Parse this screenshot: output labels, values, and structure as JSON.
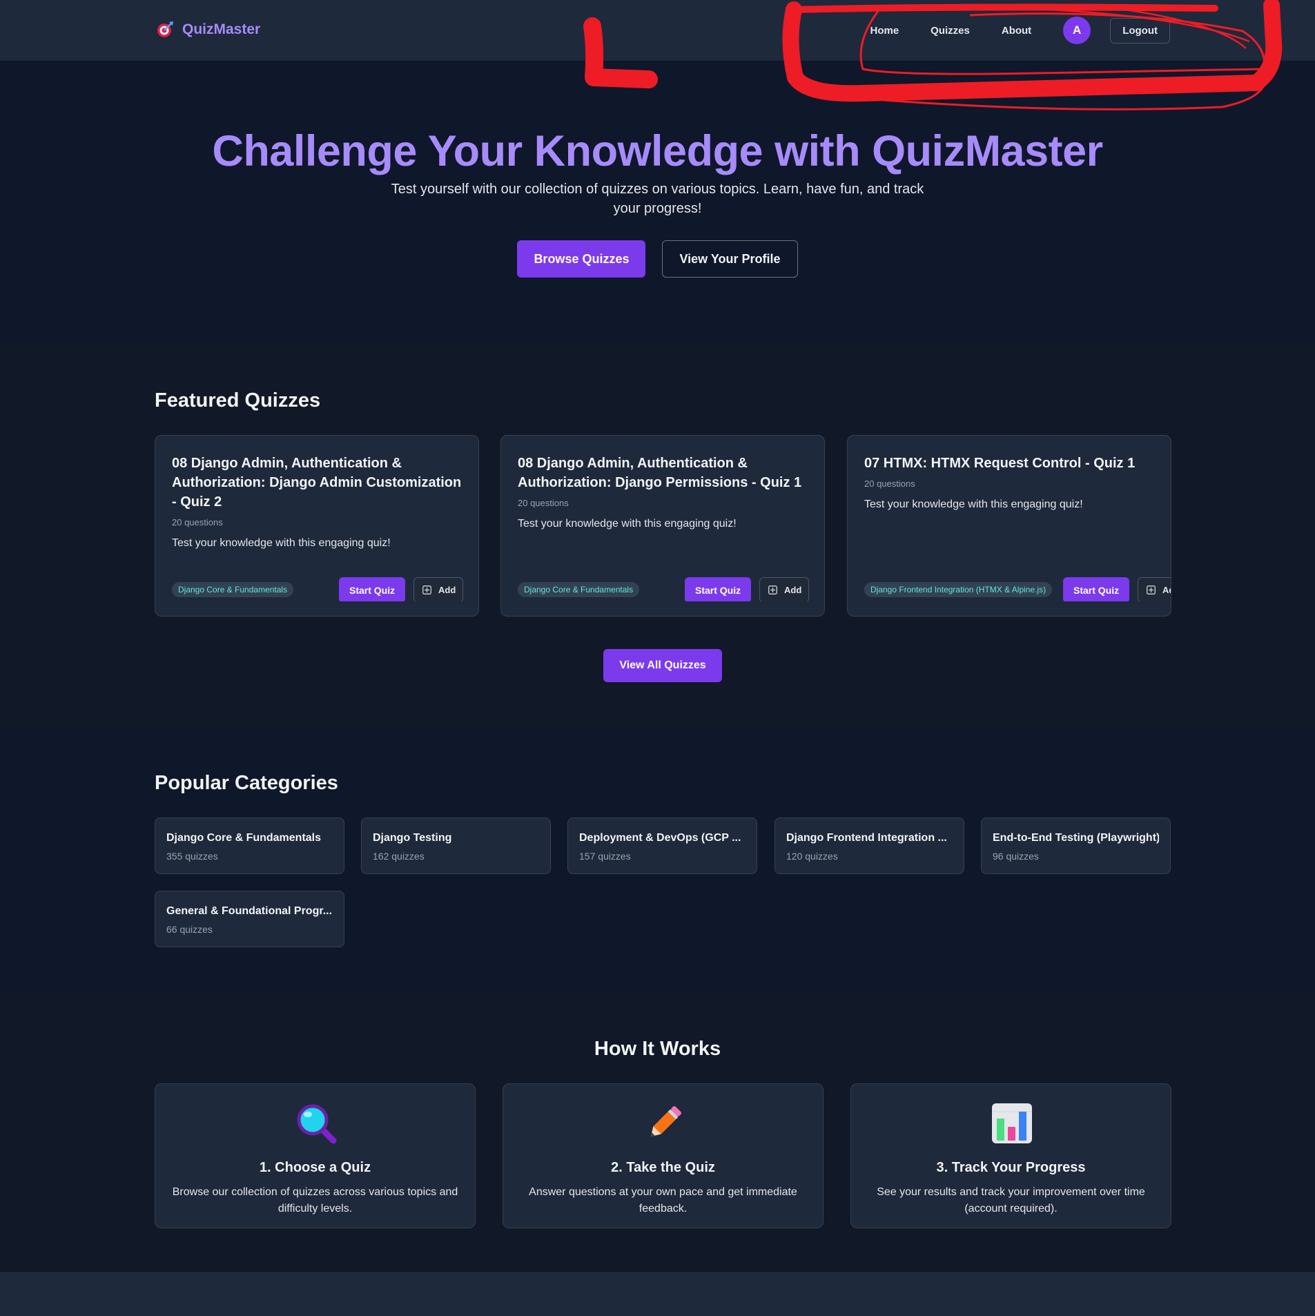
{
  "nav": {
    "brand": "QuizMaster",
    "links": [
      "Home",
      "Quizzes",
      "About"
    ],
    "avatar_initial": "A",
    "logout": "Logout"
  },
  "hero": {
    "title": "Challenge Your Knowledge with QuizMaster",
    "subtitle": "Test yourself with our collection of quizzes on various topics. Learn, have fun, and track your progress!",
    "browse_btn": "Browse Quizzes",
    "profile_btn": "View Your Profile"
  },
  "featured": {
    "title": "Featured Quizzes",
    "quizzes": [
      {
        "title": "08 Django Admin, Authentication & Authorization: Django Admin Customization - Quiz 2",
        "questions": "20 questions",
        "description": "Test your knowledge with this engaging quiz!",
        "tag": "Django Core & Fundamentals",
        "start": "Start Quiz",
        "add": "Add"
      },
      {
        "title": "08 Django Admin, Authentication & Authorization: Django Permissions - Quiz 1",
        "questions": "20 questions",
        "description": "Test your knowledge with this engaging quiz!",
        "tag": "Django Core & Fundamentals",
        "start": "Start Quiz",
        "add": "Add"
      },
      {
        "title": "07 HTMX: HTMX Request Control - Quiz 1",
        "questions": "20 questions",
        "description": "Test your knowledge with this engaging quiz!",
        "tag": "Django Frontend Integration (HTMX & Alpine.js)",
        "start": "Start Quiz",
        "add": "Add"
      }
    ],
    "view_all": "View All Quizzes"
  },
  "categories": {
    "title": "Popular Categories",
    "items": [
      {
        "name": "Django Core & Fundamentals",
        "count": "355 quizzes"
      },
      {
        "name": "Django Testing",
        "count": "162 quizzes"
      },
      {
        "name": "Deployment & DevOps (GCP ...",
        "count": "157 quizzes"
      },
      {
        "name": "Django Frontend Integration ...",
        "count": "120 quizzes"
      },
      {
        "name": "End-to-End Testing (Playwright)",
        "count": "96 quizzes"
      },
      {
        "name": "General & Foundational Progr...",
        "count": "66 quizzes"
      }
    ]
  },
  "how": {
    "title": "How It Works",
    "steps": [
      {
        "icon": "magnifying-glass-icon",
        "title": "1. Choose a Quiz",
        "description": "Browse our collection of quizzes across various topics and difficulty levels."
      },
      {
        "icon": "pencil-icon",
        "title": "2. Take the Quiz",
        "description": "Answer questions at your own pace and get immediate feedback."
      },
      {
        "icon": "bar-chart-icon",
        "title": "3. Track Your Progress",
        "description": "See your results and track your improvement over time (account required)."
      }
    ]
  },
  "colors": {
    "accent": "#7c3aed",
    "brand_text": "#a78bfa",
    "tag_text": "#5eead4",
    "annotation": "#ee1c25"
  }
}
